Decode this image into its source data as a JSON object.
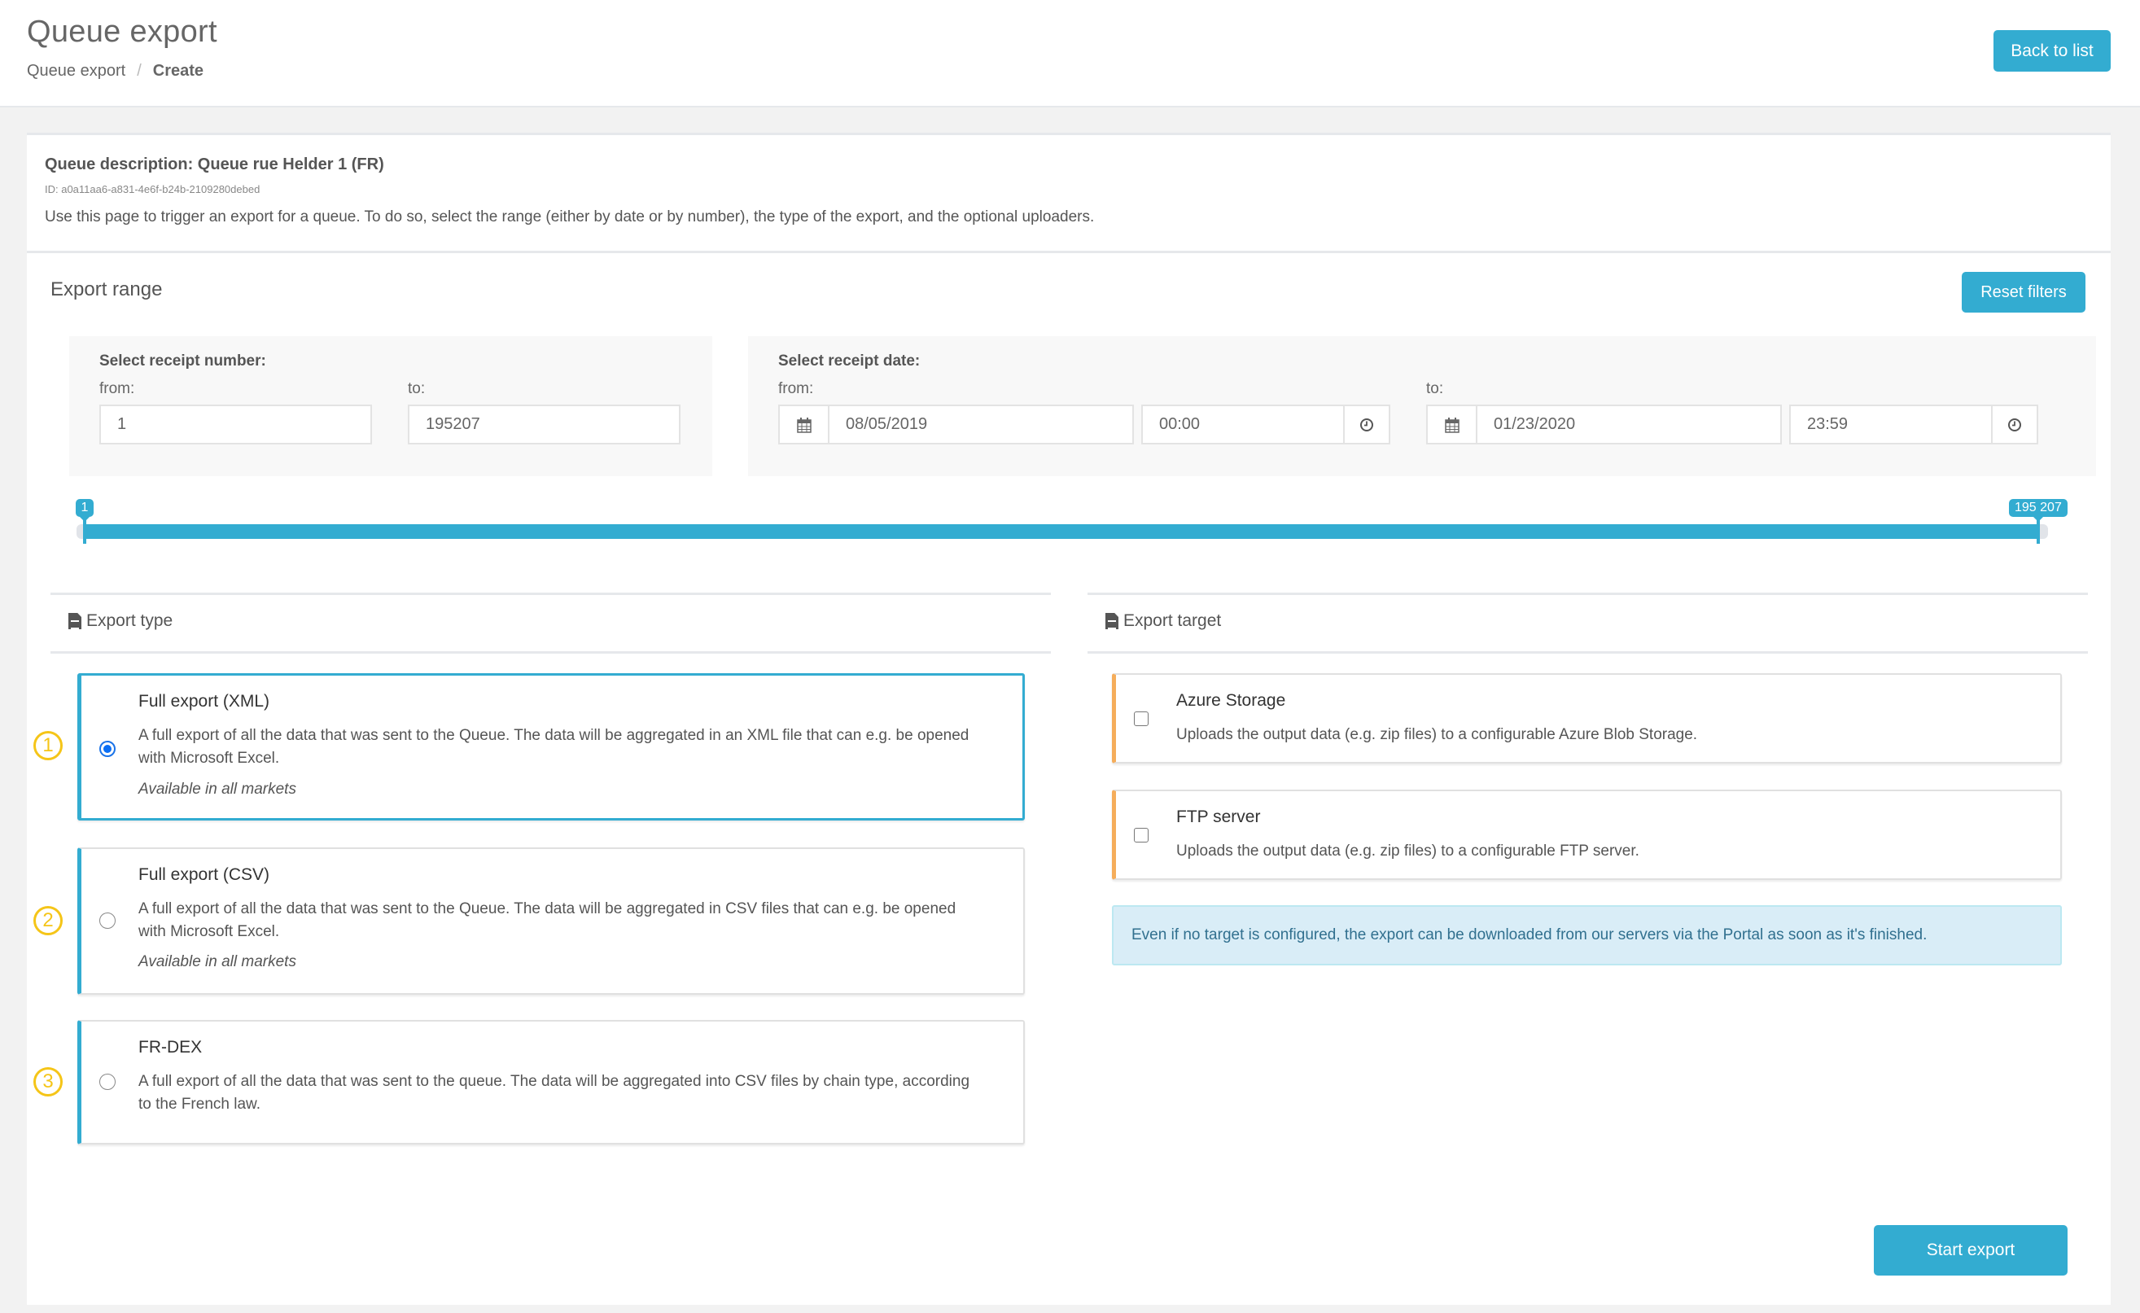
{
  "header": {
    "title": "Queue export",
    "breadcrumb": [
      "Queue export",
      "Create"
    ],
    "breadcrumb_separator": "/",
    "back_button": "Back to list"
  },
  "queue": {
    "description": "Queue description: Queue rue Helder 1 (FR)",
    "id": "ID: a0a11aa6-a831-4e6f-b24b-2109280debed",
    "instructions": "Use this page to trigger an export for a queue. To do so, select the range (either by date or by number), the type of the export, and the optional uploaders."
  },
  "range": {
    "title": "Export range",
    "reset_button": "Reset filters",
    "number": {
      "label": "Select receipt number:",
      "from_label": "from:",
      "to_label": "to:",
      "from_value": "1",
      "to_value": "195207"
    },
    "date": {
      "label": "Select receipt date:",
      "from_label": "from:",
      "to_label": "to:",
      "from_date": "08/05/2019",
      "from_time": "00:00",
      "to_date": "01/23/2020",
      "to_time": "23:59",
      "date_icon": "calendar-icon",
      "time_icon": "clock-icon"
    },
    "slider": {
      "min": 1,
      "max": 195207,
      "low": 1,
      "high": 195207,
      "low_label": "1",
      "high_label": "195 207"
    }
  },
  "export_type": {
    "title": "Export type",
    "icon": "file-icon",
    "options": [
      {
        "badge": "1",
        "title": "Full export (XML)",
        "description": "A full export of all the data that was sent to the Queue. The data will be aggregated in an XML file that can e.g. be opened with Microsoft Excel.",
        "note": "Available in all markets",
        "selected": true
      },
      {
        "badge": "2",
        "title": "Full export (CSV)",
        "description": "A full export of all the data that was sent to the Queue. The data will be aggregated in CSV files that can e.g. be opened with Microsoft Excel.",
        "note": "Available in all markets",
        "selected": false
      },
      {
        "badge": "3",
        "title": "FR-DEX",
        "description": "A full export of all the data that was sent to the queue. The data will be aggregated into CSV files by chain type, according to the French law.",
        "selected": false
      }
    ]
  },
  "export_target": {
    "title": "Export target",
    "icon": "file-icon",
    "targets": [
      {
        "title": "Azure Storage",
        "description": "Uploads the output data (e.g. zip files) to a configurable Azure Blob Storage.",
        "checked": false
      },
      {
        "title": "FTP server",
        "description": "Uploads the output data (e.g. zip files) to a configurable FTP server.",
        "checked": false
      }
    ],
    "info": "Even if no target is configured, the export can be downloaded from our servers via the Portal as soon as it's finished."
  },
  "actions": {
    "start_button": "Start export"
  },
  "colors": {
    "primary": "#33acd1",
    "target_accent": "#f5ad5b",
    "badge": "#f5c518",
    "info_bg": "#d9edf7",
    "info_text": "#31708f"
  }
}
